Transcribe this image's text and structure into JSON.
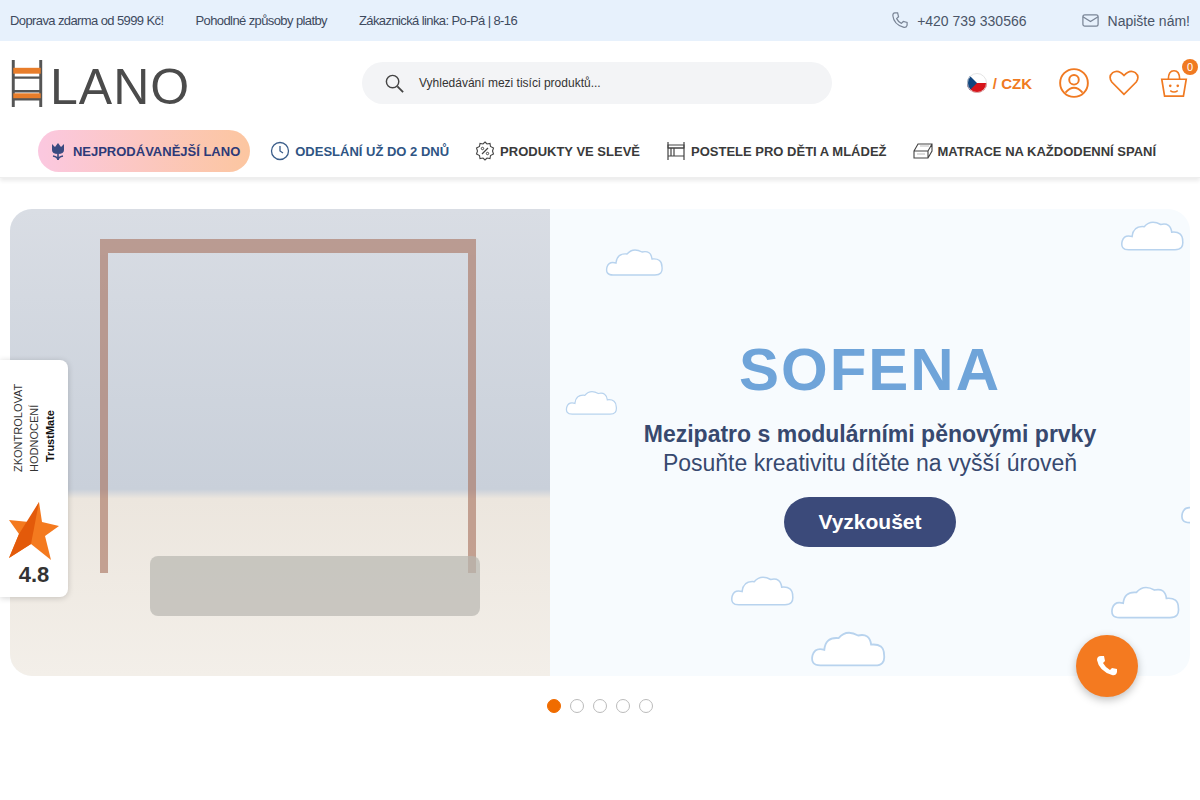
{
  "top_bar": {
    "left": [
      "Doprava zdarma od 5999 Kč!",
      "Pohodlné způsoby platby",
      "Zákaznická linka: Po-Pá | 8-16"
    ],
    "phone": "+420 739 330566",
    "contact": "Napište nám!"
  },
  "header": {
    "logo": "LANO",
    "search": {
      "placeholder": "Vyhledávání mezi tisíci produktů..."
    },
    "currency": "/ CZK",
    "cart_count": "0"
  },
  "nav": [
    {
      "label": "NEJPRODÁVANĚJŠÍ LANO",
      "kind": "promo"
    },
    {
      "label": "ODESLÁNÍ UŽ DO 2 DNŮ",
      "kind": "info"
    },
    {
      "label": "PRODUKTY VE SLEVĚ",
      "kind": "plain"
    },
    {
      "label": "POSTELE PRO DĚTI A MLÁDEŽ",
      "kind": "plain"
    },
    {
      "label": "MATRACE NA KAŽDODENNÍ SPANÍ",
      "kind": "plain"
    }
  ],
  "banner": {
    "title": "SOFENA",
    "heading": "Mezipatro s modulárními pěnovými prvky",
    "subheading": "Posuňte kreativitu dítěte na vyšší úroveň",
    "button": "Vyzkoušet"
  },
  "carousel": [
    {
      "selected": true
    },
    {
      "selected": false
    },
    {
      "selected": false
    },
    {
      "selected": false
    },
    {
      "selected": false
    }
  ],
  "rating": {
    "label": [
      "ZKONTROLOVAT",
      "HODNOCENÍ"
    ],
    "brand": "TrustMate",
    "score": "4.8"
  }
}
